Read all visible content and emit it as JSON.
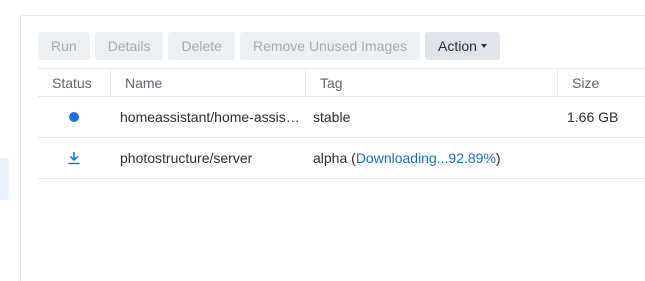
{
  "colors": {
    "accent": "#1a73e8",
    "link": "#1a6fc4",
    "disabled_text": "#a5abb2",
    "disabled_bg": "#edf0f3"
  },
  "toolbar": {
    "run_label": "Run",
    "details_label": "Details",
    "delete_label": "Delete",
    "remove_unused_label": "Remove Unused Images",
    "action_label": "Action"
  },
  "table": {
    "columns": {
      "status": "Status",
      "name": "Name",
      "tag": "Tag",
      "size": "Size"
    },
    "rows": [
      {
        "status_icon": "running-dot-icon",
        "name": "homeassistant/home-assistant",
        "tag": "stable",
        "size": "1.66 GB"
      },
      {
        "status_icon": "download-icon",
        "name": "photostructure/server",
        "tag_prefix": "alpha (",
        "tag_progress": "Downloading...92.89%",
        "tag_suffix": ")",
        "size": ""
      }
    ]
  }
}
